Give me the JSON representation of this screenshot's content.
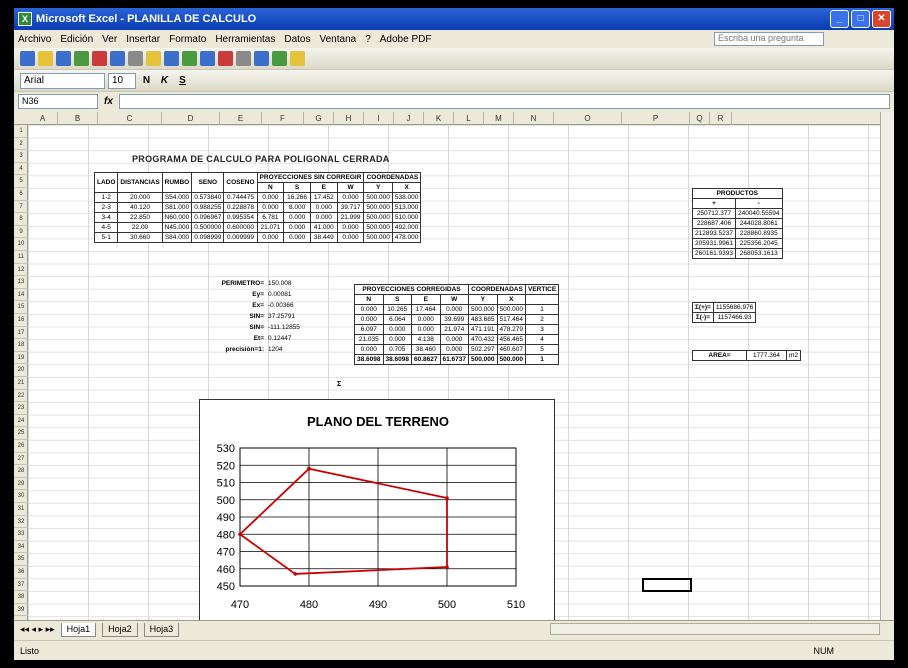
{
  "window": {
    "title": "Microsoft Excel - PLANILLA DE CALCULO"
  },
  "menu": {
    "items": [
      "Archivo",
      "Edición",
      "Ver",
      "Insertar",
      "Formato",
      "Herramientas",
      "Datos",
      "Ventana",
      "?",
      "Adobe PDF"
    ],
    "help_placeholder": "Escriba una pregunta"
  },
  "format_bar": {
    "font": "Arial",
    "size": "10"
  },
  "formula_bar": {
    "name_box": "N36",
    "fx": "fx"
  },
  "sheet": {
    "columns": [
      "A",
      "B",
      "C",
      "D",
      "E",
      "F",
      "G",
      "H",
      "I",
      "J",
      "K",
      "L",
      "M",
      "N",
      "O",
      "P",
      "Q",
      "R"
    ],
    "title": "PROGRAMA DE CALCULO PARA POLIGONAL CERRADA",
    "main_table": {
      "headers": [
        "LADO",
        "DISTANCIAS",
        "RUMBO",
        "SENO",
        "COSENO"
      ],
      "group_headers": [
        "PROYECCIONES SIN CORREGIR",
        "COORDENADAS"
      ],
      "sub_headers": [
        "N",
        "S",
        "E",
        "W",
        "Y",
        "X"
      ],
      "rows": [
        [
          "1-2",
          "20.000",
          "S54.000",
          "0.573840",
          "0.744475",
          "0.000",
          "16.266",
          "17.452",
          "0.000",
          "500.000",
          "538.000"
        ],
        [
          "2-3",
          "40.120",
          "S81.000",
          "0.988255",
          "0.228878",
          "0.000",
          "8.000",
          "0.000",
          "39.717",
          "500.000",
          "513.000"
        ],
        [
          "3-4",
          "22.850",
          "N60.000",
          "0.096967",
          "0.995354",
          "6.781",
          "0.000",
          "0.000",
          "21.999",
          "500.000",
          "510.000"
        ],
        [
          "4-5",
          "22.00",
          "N45.000",
          "0.500000",
          "0.600000",
          "21.071",
          "0.000",
          "41.000",
          "0.000",
          "500.000",
          "492.000"
        ],
        [
          "5-1",
          "30.660",
          "S84.000",
          "0.098999",
          "0.009999",
          "0.000",
          "0.000",
          "38.449",
          "0.000",
          "500.000",
          "478.000"
        ]
      ]
    },
    "params": [
      {
        "label": "PERIMETRO=",
        "value": "150.008"
      },
      {
        "label": "Ey=",
        "value": "0.00081"
      },
      {
        "label": "Ex=",
        "value": "-0.00366"
      },
      {
        "label": "SIN=",
        "value": "37.25791"
      },
      {
        "label": "SIN=",
        "value": "-111.12855"
      },
      {
        "label": "Et=",
        "value": "0.12447"
      },
      {
        "label": "precisión=1:",
        "value": "1204"
      }
    ],
    "corrected_table": {
      "group_headers": [
        "PROYECCIONES CORREGIDAS",
        "COORDENADAS",
        "VERTICE"
      ],
      "sub_headers": [
        "N",
        "S",
        "E",
        "W",
        "Y",
        "X"
      ],
      "rows": [
        [
          "0.000",
          "10.265",
          "17.464",
          "0.000",
          "500.000",
          "500.000",
          "1"
        ],
        [
          "0.000",
          "6.064",
          "0.000",
          "39.699",
          "483.685",
          "517.464",
          "2"
        ],
        [
          "6.097",
          "0.000",
          "0.000",
          "21.974",
          "471.191",
          "478.279",
          "3"
        ],
        [
          "21.035",
          "0.000",
          "4.138",
          "0.000",
          "470.432",
          "456.465",
          "4"
        ],
        [
          "0.000",
          "0.705",
          "38.460",
          "0.000",
          "502.297",
          "460.607",
          "5"
        ]
      ],
      "totals_label": "Σ",
      "totals": [
        "38.6098",
        "38.6098",
        "60.8627",
        "61.6737",
        "500.000",
        "500.000",
        "1"
      ]
    },
    "products": {
      "header": "PRODUCTOS",
      "sub": [
        "+",
        "-"
      ],
      "rows": [
        [
          "250712.377",
          "240040.55594"
        ],
        [
          "228687.406",
          "244028.8061"
        ],
        [
          "212893.5237",
          "228860.8935"
        ],
        [
          "205931.9961",
          "225356.2045"
        ],
        [
          "260161.9393",
          "268053.1613"
        ]
      ]
    },
    "sums": [
      {
        "label": "Σ(+)=",
        "value": "1155686.976"
      },
      {
        "label": "Σ(-)=",
        "value": "1157466.93"
      }
    ],
    "area": {
      "label": "AREA=",
      "value": "1777.364",
      "unit": "m2"
    }
  },
  "chart_data": {
    "type": "line",
    "title": "PLANO DEL TERRENO",
    "xlabel": "",
    "ylabel": "",
    "xlim": [
      470,
      510
    ],
    "ylim": [
      450,
      530
    ],
    "x_ticks": [
      470,
      480,
      490,
      500,
      510
    ],
    "y_ticks": [
      450,
      460,
      470,
      480,
      490,
      500,
      510,
      520,
      530
    ],
    "grid": true,
    "series": [
      {
        "x": [
          480,
          470,
          478,
          500,
          500,
          480
        ],
        "y": [
          518,
          480,
          457,
          461,
          501,
          518
        ],
        "color": "#cc0000"
      }
    ]
  },
  "sheets": {
    "tabs": [
      "Hoja1",
      "Hoja2",
      "Hoja3"
    ],
    "active": 0
  },
  "status": {
    "left": "Listo",
    "right": "NUM"
  }
}
